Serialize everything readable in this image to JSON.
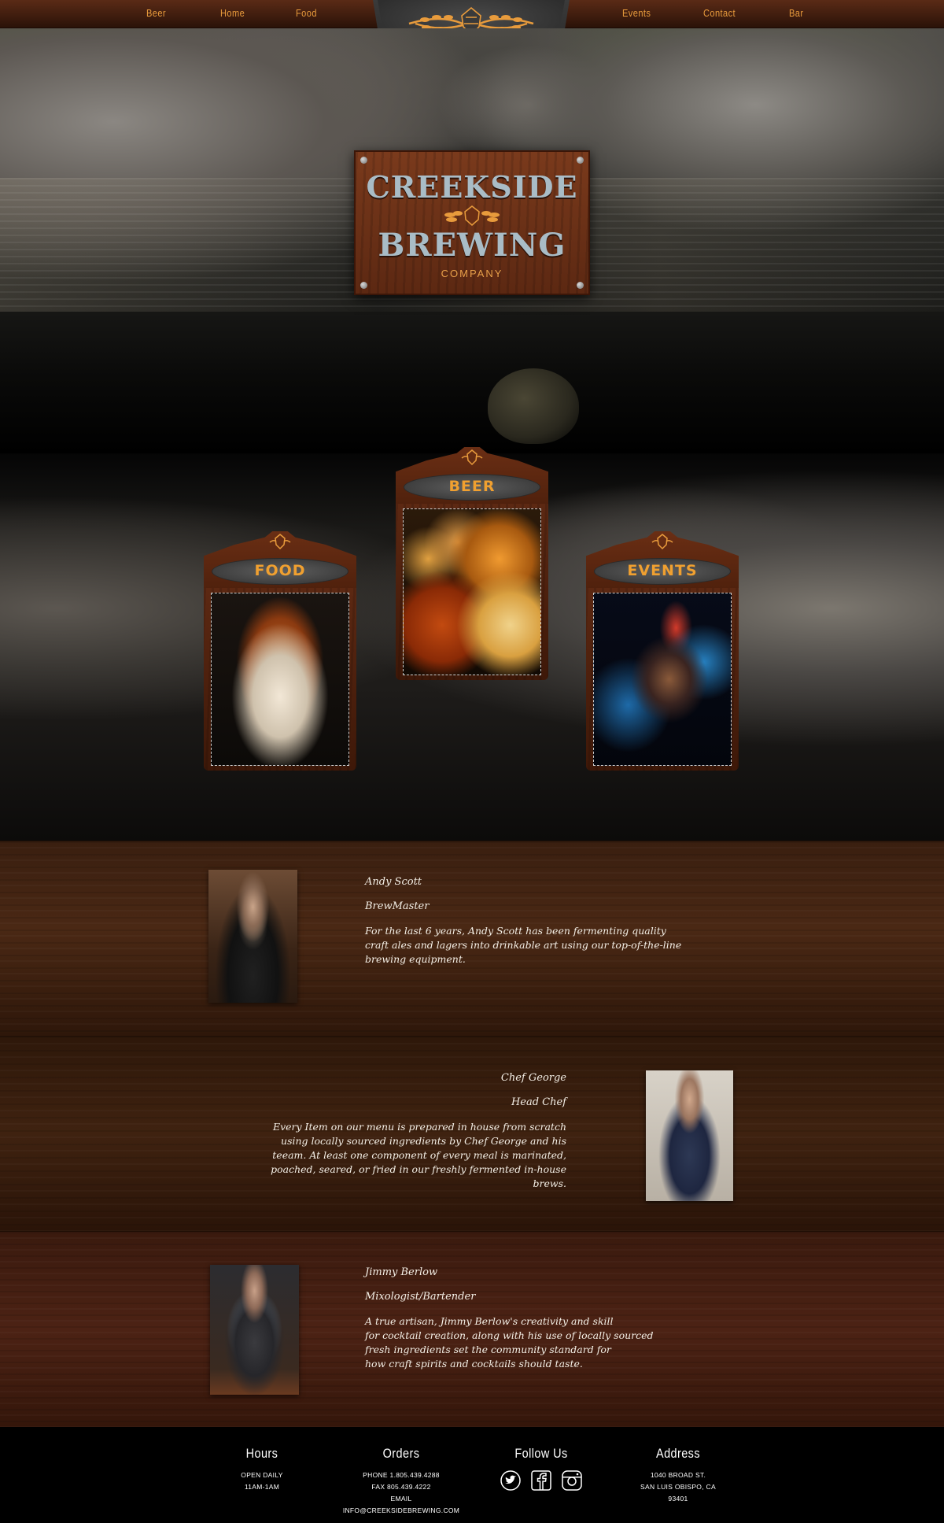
{
  "nav": {
    "left_links": [
      "Beer",
      "Home",
      "Food"
    ],
    "right_links": [
      "Events",
      "Contact",
      "Bar"
    ]
  },
  "hero": {
    "logo_line1": "CREEKSIDE",
    "logo_line2": "BREWING",
    "logo_line3": "COMPANY"
  },
  "cards": [
    {
      "label": "BEER"
    },
    {
      "label": "FOOD"
    },
    {
      "label": "EVENTS"
    }
  ],
  "staff": [
    {
      "name": "Andy Scott",
      "role": "BrewMaster",
      "bio": "For the last 6 years, Andy Scott has been fermenting quality\ncraft ales and lagers into drinkable art using our top-of-the-line\nbrewing equipment."
    },
    {
      "name": "Chef George",
      "role": "Head Chef",
      "bio": "Every Item on our menu is prepared in house from scratch\nusing locally sourced ingredients by Chef George and his\nteeam. At least one component of every meal is marinated,\npoached, seared, or fried in our freshly fermented in-house  brews."
    },
    {
      "name": "Jimmy Berlow",
      "role": "Mixologist/Bartender",
      "bio": "A true artisan, Jimmy Berlow's creativity and skill\nfor cocktail creation, along with his use of locally sourced\nfresh ingredients set the community standard for\nhow craft spirits and cocktails should taste."
    }
  ],
  "footer": {
    "hours": {
      "heading": "Hours",
      "line1": "Open Daily",
      "line2": "11am-1am"
    },
    "orders": {
      "heading": "Orders",
      "phone": "Phone 1.805.439.4288",
      "fax": "Fax 805.439.4222",
      "email_label": "Email",
      "email": "info@creeksidebrewing.com"
    },
    "follow": {
      "heading": "Follow Us",
      "icons": [
        "twitter-icon",
        "facebook-icon",
        "instagram-icon"
      ]
    },
    "address": {
      "heading": "Address",
      "line1": "1040 Broad St.",
      "line2": "San Luis Obispo, CA",
      "line3": "93401"
    }
  },
  "colors": {
    "accent_orange": "#e89b3c",
    "wood_dark": "#3e1808",
    "logo_steel": "#a9bcc6"
  }
}
